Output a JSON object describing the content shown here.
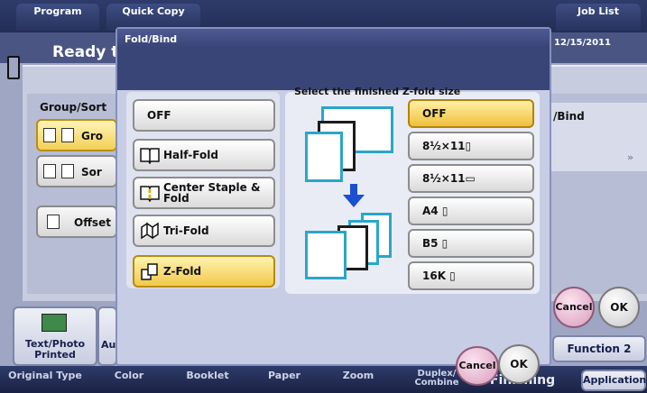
{
  "topbar": {
    "program_label": "Program",
    "quick_copy_label": "Quick Copy",
    "job_list_label": "Job List"
  },
  "status": {
    "message": "Ready t",
    "date": "12/15/2011"
  },
  "background": {
    "group_sort_label": "Group/Sort",
    "group_button_label": "Gro",
    "sort_button_label": "Sor",
    "offset_label": "Offset",
    "bind_label": "/Bind",
    "text_photo_label": "Text/Photo\nPrinted",
    "auto_label": "Au",
    "function2_label": "Function 2",
    "application_label": "Application",
    "bottom_labels": [
      "Original Type",
      "Color",
      "Booklet",
      "Paper",
      "Zoom",
      "Duplex/\nCombine",
      "Finishing"
    ],
    "cancel_label": "Cancel",
    "ok_label": "OK"
  },
  "dialog": {
    "title": "Fold/Bind",
    "fold_options": [
      {
        "label": "OFF",
        "selected": false,
        "icon": "none"
      },
      {
        "label": "Half-Fold",
        "selected": false,
        "icon": "half-fold-icon"
      },
      {
        "label": "Center Staple &\nFold",
        "selected": false,
        "icon": "center-staple-fold-icon"
      },
      {
        "label": "Tri-Fold",
        "selected": false,
        "icon": "tri-fold-icon"
      },
      {
        "label": "Z-Fold",
        "selected": true,
        "icon": "z-fold-icon"
      }
    ],
    "zfold_heading": "Select the finished Z-fold size",
    "zfold_sizes": [
      {
        "label": "OFF",
        "selected": true
      },
      {
        "label": "8½×11▯",
        "selected": false
      },
      {
        "label": "8½×11▭",
        "selected": false
      },
      {
        "label": "A4 ▯",
        "selected": false
      },
      {
        "label": "B5 ▯",
        "selected": false
      },
      {
        "label": "16K ▯",
        "selected": false
      }
    ],
    "cancel_label": "Cancel",
    "ok_label": "OK"
  },
  "colors": {
    "accent_yellow": "#f1c94a",
    "dialog_bg": "#c7cde4",
    "header_navy": "#3a4577",
    "page_outline": "#2aa6c9",
    "arrow_blue": "#1b4fd1"
  }
}
